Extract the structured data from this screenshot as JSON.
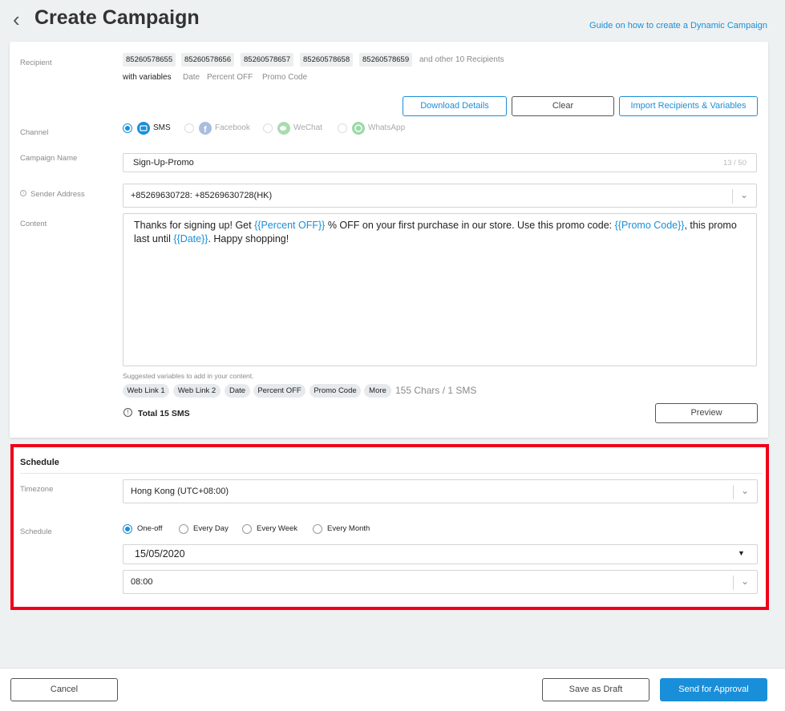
{
  "header": {
    "back_icon": "chevron-left-icon",
    "title": "Create Campaign",
    "guide_link": "Guide on how to create a Dynamic Campaign"
  },
  "recipient": {
    "label": "Recipient",
    "numbers": [
      "85260578655",
      "85260578656",
      "85260578657",
      "85260578658",
      "85260578659"
    ],
    "others": "and other 10 Recipients",
    "with_variables": "with variables",
    "variables": [
      "Date",
      "Percent OFF",
      "Promo Code"
    ],
    "buttons": {
      "download": "Download Details",
      "clear": "Clear",
      "import": "Import Recipients & Variables"
    }
  },
  "channel": {
    "label": "Channel",
    "options": [
      {
        "name": "SMS",
        "icon": "sms-icon",
        "selected": true
      },
      {
        "name": "Facebook",
        "icon": "facebook-icon",
        "selected": false
      },
      {
        "name": "WeChat",
        "icon": "wechat-icon",
        "selected": false
      },
      {
        "name": "WhatsApp",
        "icon": "whatsapp-icon",
        "selected": false
      }
    ]
  },
  "campaign_name": {
    "label": "Campaign Name",
    "value": "Sign-Up-Promo",
    "counter": "13 / 50"
  },
  "sender": {
    "label": "Sender Address",
    "info_icon": "info-icon",
    "value": "+85269630728: +85269630728(HK)"
  },
  "content": {
    "label": "Content",
    "segments": [
      "Thanks for signing up! Get ",
      "{{Percent OFF}}",
      " % OFF on your first purchase in our store. Use this promo code: ",
      "{{Promo Code}}",
      ", this promo last until ",
      "{{Date}}",
      ". Happy shopping!"
    ],
    "suggested_label": "Suggested variables to add in your content.",
    "suggested": [
      "Web Link 1",
      "Web Link 2",
      "Date",
      "Percent OFF",
      "Promo Code",
      "More"
    ],
    "chars_info": "155 Chars / 1 SMS",
    "total": "Total 15 SMS",
    "preview": "Preview"
  },
  "schedule": {
    "section_title": "Schedule",
    "timezone_label": "Timezone",
    "timezone_value": "Hong Kong (UTC+08:00)",
    "schedule_label": "Schedule",
    "options": [
      {
        "name": "One-off",
        "selected": true
      },
      {
        "name": "Every Day",
        "selected": false
      },
      {
        "name": "Every Week",
        "selected": false
      },
      {
        "name": "Every Month",
        "selected": false
      }
    ],
    "date": "15/05/2020",
    "time": "08:00"
  },
  "footer": {
    "cancel": "Cancel",
    "save_draft": "Save as Draft",
    "send": "Send for Approval"
  },
  "colors": {
    "accent": "#1a8fd9",
    "highlight_border": "#f00019",
    "background": "#eef1f2"
  }
}
